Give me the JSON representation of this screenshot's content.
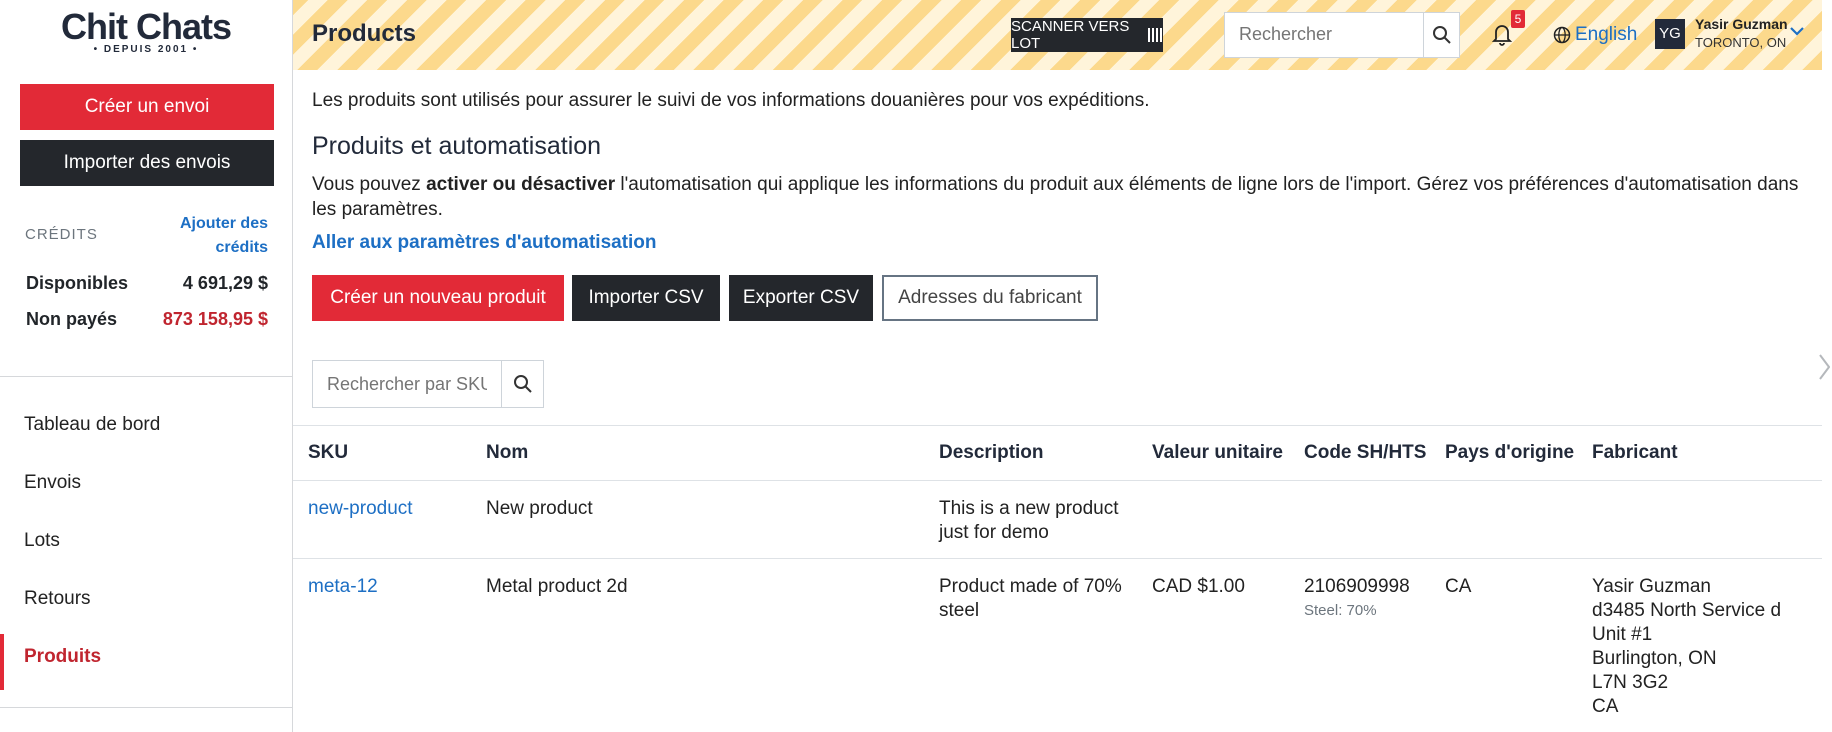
{
  "brand": {
    "name": "Chit Chats",
    "tagline": "• DEPUIS 2001 •"
  },
  "sidebar": {
    "create_shipment": "Créer un envoi",
    "import_shipments": "Importer des envois",
    "credits": {
      "label": "CRÉDITS",
      "add_link": "Ajouter des crédits",
      "available_label": "Disponibles",
      "available_value": "4 691,29 $",
      "unpaid_label": "Non payés",
      "unpaid_value": "873 158,95 $"
    },
    "nav": [
      "Tableau de bord",
      "Envois",
      "Lots",
      "Retours",
      "Produits"
    ],
    "active_nav": "Produits"
  },
  "header": {
    "title": "Products",
    "scan_button": "SCANNER VERS LOT",
    "search_placeholder": "Rechercher",
    "notification_count": "5",
    "language": "English",
    "user": {
      "initials": "YG",
      "name": "Yasir Guzman",
      "location": "TORONTO, ON"
    }
  },
  "main": {
    "intro": "Les produits sont utilisés pour assurer le suivi de vos informations douanières pour vos expéditions.",
    "section_title": "Produits et automatisation",
    "automation_text_1": "Vous pouvez ",
    "automation_text_bold": "activer ou désactiver",
    "automation_text_2": " l'automatisation qui applique les informations du produit aux éléments de ligne lors de l'import. Gérez vos préférences d'automatisation dans les paramètres.",
    "automation_link": "Aller aux paramètres d'automatisation",
    "buttons": {
      "create_product": "Créer un nouveau produit",
      "import_csv": "Importer CSV",
      "export_csv": "Exporter CSV",
      "manufacturer_addresses": "Adresses du fabricant"
    },
    "sku_search_placeholder": "Rechercher par SKU",
    "table": {
      "headers": [
        "SKU",
        "Nom",
        "Description",
        "Valeur unitaire",
        "Code SH/HTS",
        "Pays d'origine",
        "Fabricant"
      ],
      "rows": [
        {
          "sku": "new-product",
          "name": "New product",
          "description": "This is a new product just for demo",
          "unit_value": "",
          "hs_code": "",
          "hs_sub": "",
          "origin": "",
          "manufacturer": ""
        },
        {
          "sku": "meta-12",
          "name": "Metal product 2d",
          "description": "Product made of 70% steel",
          "unit_value": "CAD $1.00",
          "hs_code": "2106909998",
          "hs_sub": "Steel: 70%",
          "origin": "CA",
          "manufacturer": "Yasir Guzman\nd3485 North Service d\nUnit #1\nBurlington, ON\nL7N 3G2\nCA"
        }
      ]
    }
  },
  "colors": {
    "brand_red": "#e22a37",
    "dark": "#24272c",
    "link_blue": "#1d6fc4",
    "stripe_yellow": "#fcd98c"
  }
}
